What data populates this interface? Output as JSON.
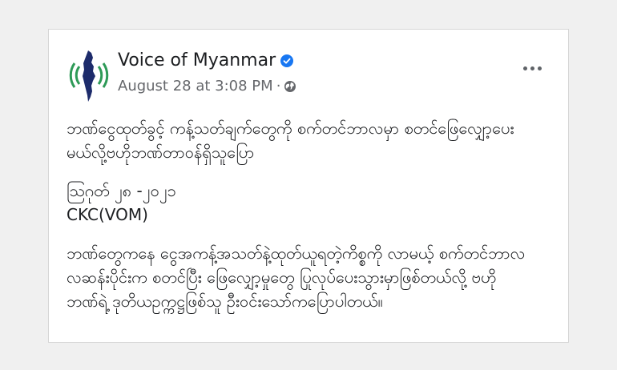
{
  "post": {
    "page_name": "Voice of Myanmar",
    "date": "August 28 at 3:08 PM",
    "separator": "·",
    "paragraphs": {
      "headline_line1": "ဘဏ်ငွေထုတ်ခွင့် ကန့်သတ်ချက်တွေကို စက်တင်ဘာလမှာ စတင်ဖြေလျှော့ပေး",
      "headline_line2": "မယ်လို့ဗဟိုဘဏ်တာဝန်ရှိသူပြော",
      "dateline": "ဩဂုတ် ၂၈ -၂၀၂၁",
      "source": "CKC(VOM)",
      "body_line1": "ဘဏ်တွေကနေ ငွေအကန့်အသတ်နဲ့ထုတ်ယူရတဲ့ကိစ္စကို လာမယ့် စက်တင်ဘာလ",
      "body_line2": "လဆန်းပိုင်းက စတင်ပြီး ဖြေလျှော့မှုတွေ ပြုလုပ်ပေးသွားမှာဖြစ်တယ်လို့ ဗဟို",
      "body_line3": "ဘဏ်ရဲ့ ဒုတိယဥက္ကဋ္ဌဖြစ်သူ ဦးဝင်းသော်ကပြောပါတယ်။"
    }
  },
  "icons": {
    "avatar": "myanmar-map-logo",
    "verified": "verified-badge-icon",
    "audience": "globe-icon",
    "more": "more-options-icon"
  },
  "colors": {
    "verified_blue": "#1877f2",
    "logo_green": "#2e9a57",
    "logo_navy": "#1d2b6b"
  }
}
